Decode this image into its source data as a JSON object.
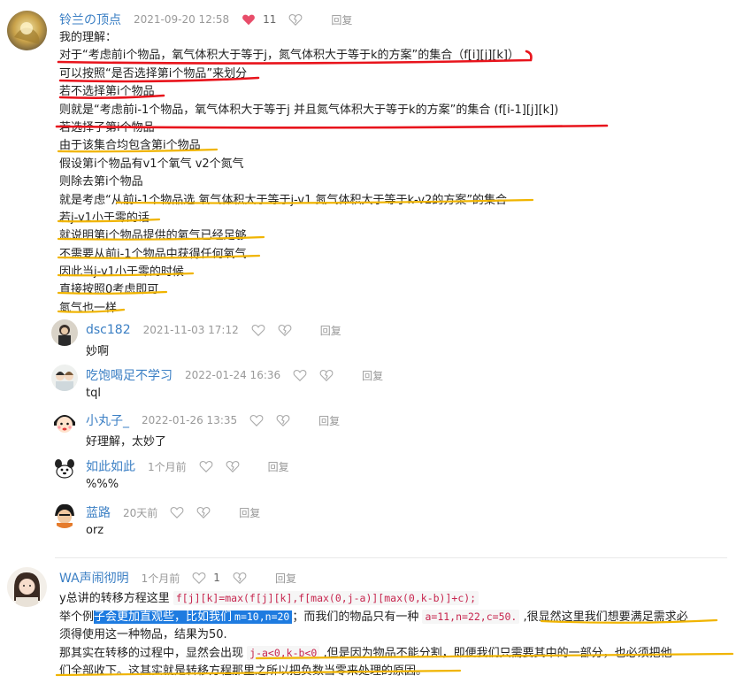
{
  "colors": {
    "username": "#3b7fc4",
    "meta": "#999999",
    "liked": "#e84d6a",
    "red_pen": "#e8141c",
    "yellow_pen": "#f0b400",
    "selection": "#1e7be0"
  },
  "comment1": {
    "user": "铃兰の顶点",
    "time": "2021-09-20 12:58",
    "likes": "11",
    "reply": "回复",
    "lines": [
      "我的理解：",
      "对于“考虑前i个物品，氧气体积大于等于j，氮气体积大于等于k的方案”的集合（f[i][j][k]）",
      "可以按照“是否选择第i个物品”来划分",
      "若不选择第i个物品",
      "则就是“考虑前i-1个物品，氧气体积大于等于j 并且氮气体积大于等于k的方案”的集合 (f[i-1][j][k])",
      "若选择了第i个物品",
      "由于该集合均包含第i个物品",
      "假设第i个物品有v1个氧气 v2个氮气",
      "则除去第i个物品",
      "就是考虑“从前i-1个物品选 氧气体积大于等于j-v1 氮气体积大于等于k-v2的方案”的集合",
      "若j-v1小于零的话",
      "就说明第i个物品提供的氧气已经足够",
      "不需要从前i-1个物品中获得任何氧气",
      "因此当j-v1小于零的时候",
      "直接按照0考虑即可",
      "氮气也一样"
    ]
  },
  "replies": [
    {
      "user": "dsc182",
      "time": "2021-11-03 17:12",
      "text": "妙啊",
      "reply": "回复"
    },
    {
      "user": "吃饱喝足不学习",
      "time": "2022-01-24 16:36",
      "text": "tql",
      "reply": "回复"
    },
    {
      "user": "小丸子_",
      "time": "2022-01-26 13:35",
      "text": "好理解，太妙了",
      "reply": "回复"
    },
    {
      "user": "如此如此",
      "time": "1个月前",
      "text": "%%%",
      "reply": "回复"
    },
    {
      "user": "蓝路",
      "time": "20天前",
      "text": "orz",
      "reply": "回复"
    }
  ],
  "comment2": {
    "user": "WA声闹彻明",
    "time": "1个月前",
    "likes": "1",
    "reply": "回复",
    "line1_text": "y总讲的转移方程这里 ",
    "line1_code": "f[j][k]=max(f[j][k],f[max(0,j-a)][max(0,k-b)]+c);",
    "line2_a": "举个例",
    "line2_sel": "子会更加直观些，比如我们",
    "line2_code1": "m=10,n=20",
    "line2_b": "；而我们的物品只有一种 ",
    "line2_code2": "a=11,n=22,c=50.",
    "line2_c": " ,很显然这里我们想要满足需求必",
    "line3": "须得使用这一种物品，结果为50.",
    "line4_a": "那其实在转移的过程中，显然会出现 ",
    "line4_code": "j-a<0,k-b<0",
    "line4_b": " ,但是因为物品不能分割，即便我们只需要其中的一部分，也必须把他",
    "line5": "们全部收下。这其实就是转移方程那里之所以把负数当零来处理的原因。"
  }
}
